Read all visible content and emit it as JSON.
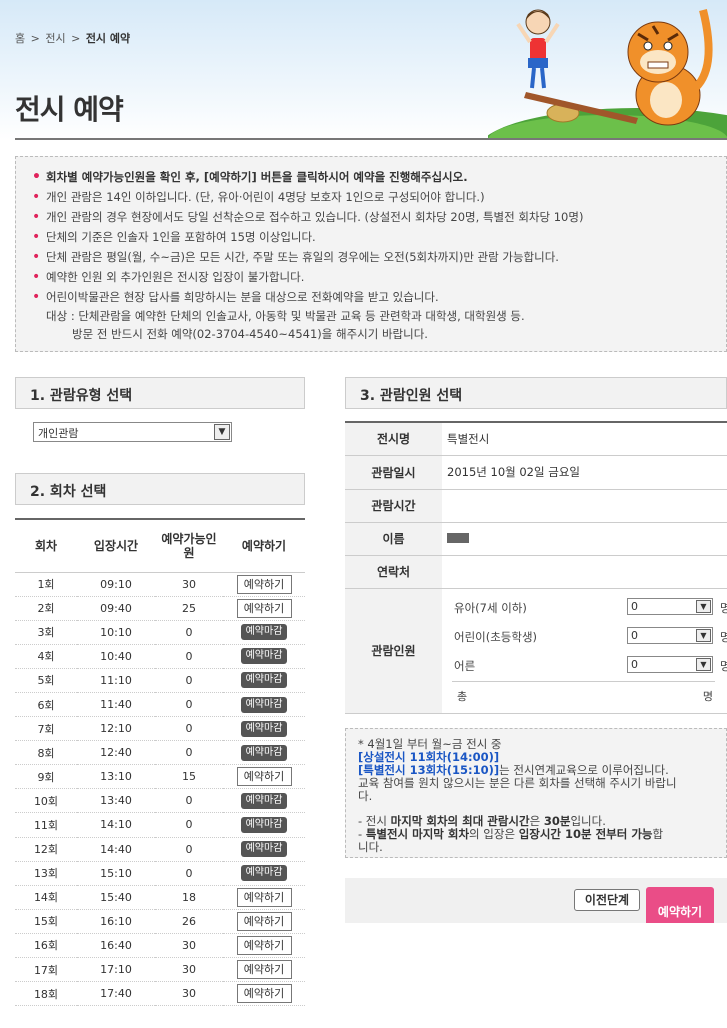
{
  "breadcrumb": [
    "홈",
    "전시",
    "전시 예약"
  ],
  "page_title": "전시 예약",
  "notice": {
    "items": [
      "회차별 예약가능인원을 확인 후, [예약하기] 버튼을 클릭하시어 예약을 진행해주십시오.",
      "개인 관람은 14인 이하입니다. (단, 유아·어린이 4명당 보호자 1인으로 구성되어야 합니다.)",
      "개인 관람의 경우 현장에서도 당일 선착순으로 접수하고 있습니다. (상설전시 회차당 20명, 특별전 회차당 10명)",
      "단체의 기준은 인솔자 1인을 포함하여 15명 이상입니다.",
      "단체 관람은 평일(월, 수~금)은 모든 시간, 주말 또는 휴일의 경우에는 오전(5회차까지)만 관람 가능합니다.",
      "예약한 인원 외 추가인원은 전시장 입장이 불가합니다.",
      "어린이박물관은 현장 답사를 희망하시는 분을 대상으로 전화예약을 받고 있습니다."
    ],
    "sub_lines": [
      "대상 : 단체관람을 예약한 단체의 인솔교사, 아동학 및 박물관 교육 등 관련학과 대학생, 대학원생 등.",
      "방문 전 반드시 전화 예약(02-3704-4540~4541)을 해주시기 바랍니다."
    ]
  },
  "section1": {
    "title": "1. 관람유형 선택",
    "selected": "개인관람"
  },
  "section2": {
    "title": "2. 회차 선택",
    "headers": [
      "회차",
      "입장시간",
      "예약가능인원",
      "예약하기"
    ],
    "header_avail_line1": "예약가능인",
    "header_avail_line2": "원",
    "reserve_label": "예약하기",
    "closed_label": "예약마감",
    "rows": [
      {
        "no": "1회",
        "time": "09:10",
        "avail": "30",
        "status": "open"
      },
      {
        "no": "2회",
        "time": "09:40",
        "avail": "25",
        "status": "open"
      },
      {
        "no": "3회",
        "time": "10:10",
        "avail": "0",
        "status": "closed"
      },
      {
        "no": "4회",
        "time": "10:40",
        "avail": "0",
        "status": "closed"
      },
      {
        "no": "5회",
        "time": "11:10",
        "avail": "0",
        "status": "closed"
      },
      {
        "no": "6회",
        "time": "11:40",
        "avail": "0",
        "status": "closed"
      },
      {
        "no": "7회",
        "time": "12:10",
        "avail": "0",
        "status": "closed"
      },
      {
        "no": "8회",
        "time": "12:40",
        "avail": "0",
        "status": "closed"
      },
      {
        "no": "9회",
        "time": "13:10",
        "avail": "15",
        "status": "open"
      },
      {
        "no": "10회",
        "time": "13:40",
        "avail": "0",
        "status": "closed"
      },
      {
        "no": "11회",
        "time": "14:10",
        "avail": "0",
        "status": "closed"
      },
      {
        "no": "12회",
        "time": "14:40",
        "avail": "0",
        "status": "closed"
      },
      {
        "no": "13회",
        "time": "15:10",
        "avail": "0",
        "status": "closed"
      },
      {
        "no": "14회",
        "time": "15:40",
        "avail": "18",
        "status": "open"
      },
      {
        "no": "15회",
        "time": "16:10",
        "avail": "26",
        "status": "open"
      },
      {
        "no": "16회",
        "time": "16:40",
        "avail": "30",
        "status": "open"
      },
      {
        "no": "17회",
        "time": "17:10",
        "avail": "30",
        "status": "open"
      },
      {
        "no": "18회",
        "time": "17:40",
        "avail": "30",
        "status": "open"
      }
    ]
  },
  "section3": {
    "title": "3. 관람인원 선택",
    "exhibit_label": "전시명",
    "exhibit_value": "특별전시",
    "date_label": "관람일시",
    "date_value": "2015년 10월 02일 금요일",
    "time_label": "관람시간",
    "time_value": "",
    "name_label": "이름",
    "contact_label": "연락처",
    "contact_value": "",
    "visitors_label": "관람인원",
    "counts": [
      {
        "label": "유아(7세 이하)",
        "value": "0",
        "unit": "명"
      },
      {
        "label": "어린이(초등학생)",
        "value": "0",
        "unit": "명"
      },
      {
        "label": "어른",
        "value": "0",
        "unit": "명"
      }
    ],
    "total_label": "총",
    "total_unit": "명"
  },
  "info": {
    "line1": "* 4월1일 부터 월~금 전시 중",
    "blue1": "[상설전시 11회차(14:00)]",
    "blue2": "[특별전시 13회차(15:10)]",
    "blue2_suffix": "는 전시연계교육으로 이루어집니다.",
    "line3": "교육 참여를 원치 않으시는 분은 다른 회차를 선택해 주시기 바랍니",
    "line3b": "다.",
    "note1_pre": "- 전시 ",
    "note1_bold1": "마지막 회차의 최대 관람시간",
    "note1_mid": "은 ",
    "note1_bold2": "30분",
    "note1_post": "입니다.",
    "note2_pre": "- ",
    "note2_bold1": "특별전시 마지막 회차",
    "note2_mid": "의 입장은 ",
    "note2_bold2": "입장시간 10분 전부터 가능",
    "note2_post": "합",
    "note2_tail": "니다."
  },
  "actions": {
    "prev_label": "이전단계",
    "submit_label": "예약하기"
  },
  "colors": {
    "accent": "#e0225b",
    "submit": "#ea4d87",
    "link_blue": "#1a56c4"
  }
}
